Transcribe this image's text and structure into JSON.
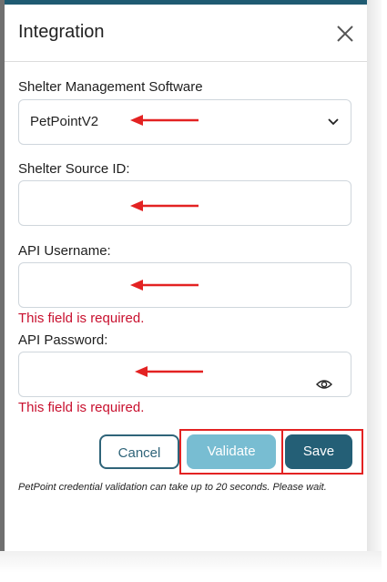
{
  "modal": {
    "title": "Integration",
    "close_icon": "close-icon"
  },
  "fields": {
    "software": {
      "label": "Shelter Management Software",
      "value": "PetPointV2",
      "icon": "chevron-down-icon"
    },
    "source_id": {
      "label": "Shelter Source ID:",
      "value": ""
    },
    "username": {
      "label": "API Username:",
      "value": "",
      "error": "This field is required."
    },
    "password": {
      "label": "API Password:",
      "value": "",
      "error": "This field is required.",
      "icon": "eye-icon"
    }
  },
  "buttons": {
    "cancel": "Cancel",
    "validate": "Validate",
    "save": "Save"
  },
  "note": "PetPoint credential validation can take up to 20 seconds. Please wait.",
  "colors": {
    "accent": "#245f76",
    "validate_bg": "#78bdd2",
    "error": "#c8102e",
    "annotation": "#e32222"
  }
}
